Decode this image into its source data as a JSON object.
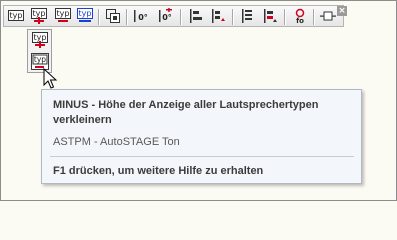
{
  "toolbar": {
    "icons": [
      "typ-icon",
      "typ-plus-icon",
      "typ-minus-icon",
      "typ-reset-icon",
      "select-object-icon",
      "zero-degree-icon",
      "rotate-degree-icon",
      "align-left-icon",
      "align-left-arrow-icon",
      "align-center-icon",
      "align-right-icon",
      "text-fo-icon",
      "network-icon"
    ],
    "close_glyph": "×"
  },
  "flyout": {
    "icons": [
      "typ-plus-icon",
      "typ-minus-icon"
    ]
  },
  "tooltip": {
    "title": "MINUS - Höhe der Anzeige aller Lautsprechertypen verkleinern",
    "subtitle": "ASTPM - AutoSTAGE Ton",
    "help": "F1 drücken, um weitere Hilfe zu erhalten"
  },
  "colors": {
    "icon_red": "#d0021b",
    "icon_blue": "#1a3fd6",
    "tooltip_bg": "#f3f6fa",
    "workspace_bg": "#fcfbf3"
  }
}
